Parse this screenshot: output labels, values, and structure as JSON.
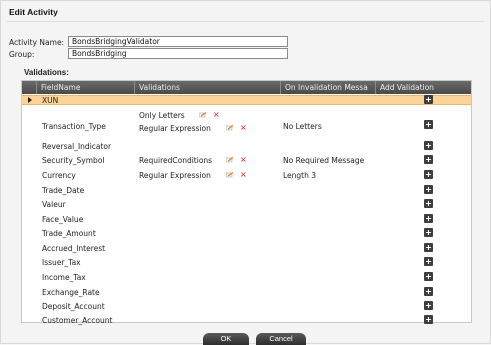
{
  "dialog": {
    "title": "Edit Activity"
  },
  "form": {
    "activity_name_label": "Activity Name:",
    "activity_name_value": "BondsBridgingValidator",
    "group_label": "Group:",
    "group_value": "BondsBridging"
  },
  "validations_title": "Validations:",
  "grid": {
    "columns": [
      "FieldName",
      "Validations",
      "On Invalidation Messa",
      "Add Validation"
    ],
    "rows": [
      {
        "field": "XUN",
        "validations": [],
        "message": "",
        "selected": true
      },
      {
        "field": "Transaction_Type",
        "validations": [
          "Only Letters",
          "Regular Expression"
        ],
        "message": "No Letters"
      },
      {
        "field": "Reversal_Indicator",
        "validations": [],
        "message": ""
      },
      {
        "field": "Security_Symbol",
        "validations": [
          "RequiredConditions"
        ],
        "message": "No Required Message"
      },
      {
        "field": "Currency",
        "validations": [
          "Regular Expression"
        ],
        "message": "Length 3"
      },
      {
        "field": "Trade_Date",
        "validations": [],
        "message": ""
      },
      {
        "field": "Valeur",
        "validations": [],
        "message": ""
      },
      {
        "field": "Face_Value",
        "validations": [],
        "message": ""
      },
      {
        "field": "Trade_Amount",
        "validations": [],
        "message": ""
      },
      {
        "field": "Accrued_Interest",
        "validations": [],
        "message": ""
      },
      {
        "field": "Issuer_Tax",
        "validations": [],
        "message": ""
      },
      {
        "field": "Income_Tax",
        "validations": [],
        "message": ""
      },
      {
        "field": "Exchange_Rate",
        "validations": [],
        "message": ""
      },
      {
        "field": "Deposit_Account",
        "validations": [],
        "message": ""
      },
      {
        "field": "Customer_Account",
        "validations": [],
        "message": ""
      }
    ]
  },
  "buttons": {
    "ok": "OK",
    "cancel": "Cancel"
  },
  "colors": {
    "selected_row": "#fbd49a",
    "header": "#555555",
    "delete_icon": "#e05050"
  }
}
